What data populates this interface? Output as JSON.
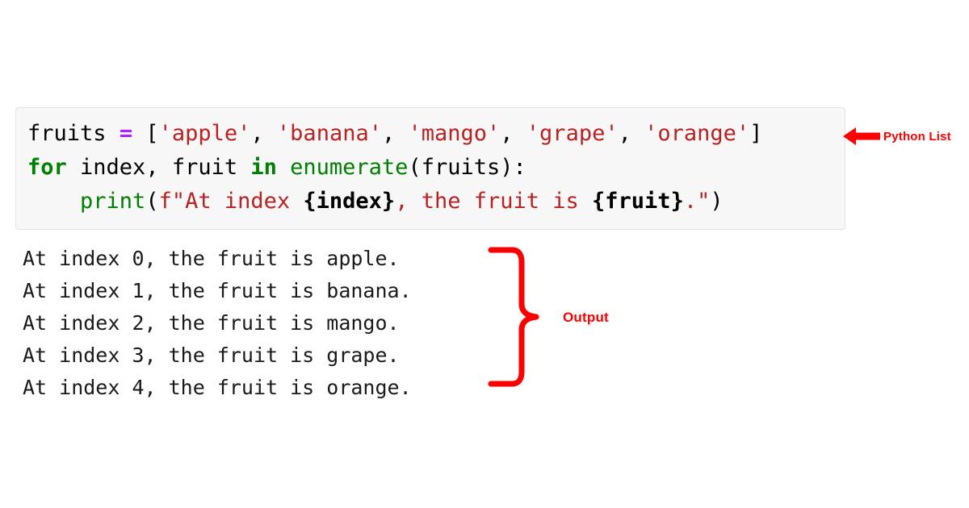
{
  "colors": {
    "page_background": "#ffffff",
    "code_background": "#f7f7f7",
    "code_border": "#e3e3e3",
    "annotation_red": "#ff0000",
    "string_red": "#ba2121",
    "keyword_green": "#008000",
    "operator_purple": "#aa22ff",
    "text_black": "#000000"
  },
  "code": {
    "language": "python",
    "lines": [
      {
        "tokens": [
          {
            "text": "fruits",
            "type": "name"
          },
          {
            "text": " ",
            "type": "ws"
          },
          {
            "text": "=",
            "type": "op"
          },
          {
            "text": " ",
            "type": "ws"
          },
          {
            "text": "[",
            "type": "punct"
          },
          {
            "text": "'apple'",
            "type": "str"
          },
          {
            "text": ", ",
            "type": "punct"
          },
          {
            "text": "'banana'",
            "type": "str"
          },
          {
            "text": ", ",
            "type": "punct"
          },
          {
            "text": "'mango'",
            "type": "str"
          },
          {
            "text": ", ",
            "type": "punct"
          },
          {
            "text": "'grape'",
            "type": "str"
          },
          {
            "text": ", ",
            "type": "punct"
          },
          {
            "text": "'orange'",
            "type": "str"
          },
          {
            "text": "]",
            "type": "punct"
          }
        ]
      },
      {
        "tokens": [
          {
            "text": "for",
            "type": "kw"
          },
          {
            "text": " index, fruit ",
            "type": "name"
          },
          {
            "text": "in",
            "type": "kw"
          },
          {
            "text": " ",
            "type": "ws"
          },
          {
            "text": "enumerate",
            "type": "builtin"
          },
          {
            "text": "(fruits):",
            "type": "punct"
          }
        ]
      },
      {
        "tokens": [
          {
            "text": "    ",
            "type": "ws"
          },
          {
            "text": "print",
            "type": "builtin"
          },
          {
            "text": "(",
            "type": "punct"
          },
          {
            "text": "f\"At index ",
            "type": "fstr"
          },
          {
            "text": "{index}",
            "type": "brace"
          },
          {
            "text": ", the fruit is ",
            "type": "fstr"
          },
          {
            "text": "{fruit}",
            "type": "brace"
          },
          {
            "text": ".\"",
            "type": "fstr"
          },
          {
            "text": ")",
            "type": "punct"
          }
        ]
      }
    ]
  },
  "output": {
    "lines": [
      "At index 0, the fruit is apple.",
      "At index 1, the fruit is banana.",
      "At index 2, the fruit is mango.",
      "At index 3, the fruit is grape.",
      "At index 4, the fruit is orange."
    ]
  },
  "annotations": {
    "python_list": {
      "label": "Python List",
      "marker": "left-arrow",
      "color": "#ff0000"
    },
    "output": {
      "label": "Output",
      "marker": "right-curly-brace",
      "color": "#ff0000"
    }
  }
}
